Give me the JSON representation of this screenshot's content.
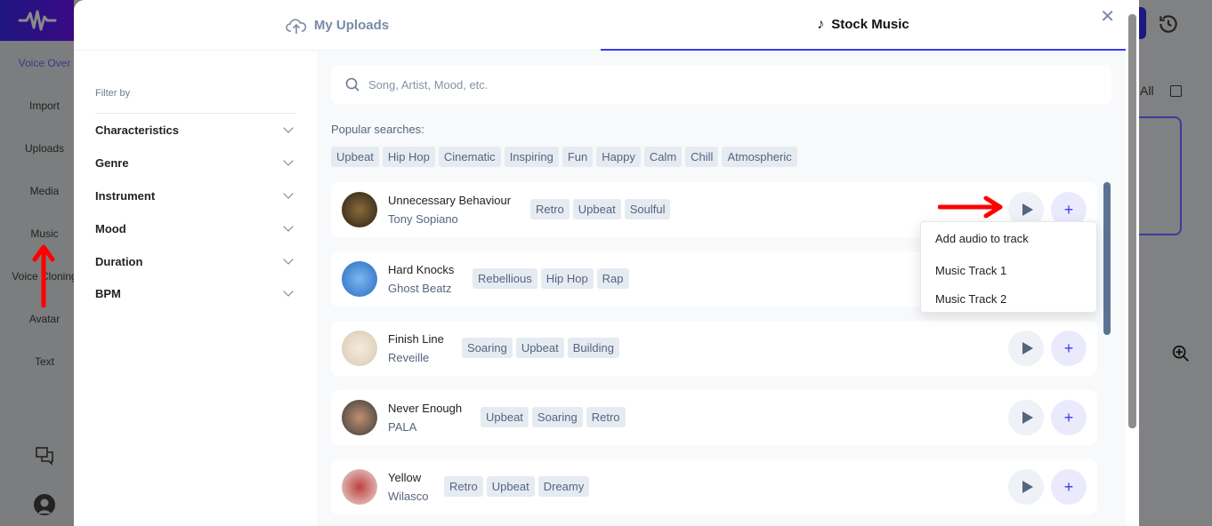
{
  "sidebar": {
    "items": [
      "Voice Over",
      "Import",
      "Uploads",
      "Media",
      "Music",
      "Voice Cloning",
      "Avatar",
      "Text"
    ]
  },
  "background": {
    "select_all": "t All"
  },
  "tabs": {
    "uploads": "My Uploads",
    "stock": "Stock Music"
  },
  "filter": {
    "title": "Filter by",
    "items": [
      "Characteristics",
      "Genre",
      "Instrument",
      "Mood",
      "Duration",
      "BPM"
    ]
  },
  "search": {
    "placeholder": "Song, Artist, Mood, etc."
  },
  "popular": {
    "label": "Popular searches:",
    "chips": [
      "Upbeat",
      "Hip Hop",
      "Cinematic",
      "Inspiring",
      "Fun",
      "Happy",
      "Calm",
      "Chill",
      "Atmospheric"
    ]
  },
  "tracks": [
    {
      "name": "Unnecessary Behaviour",
      "artist": "Tony Sopiano",
      "tags": [
        "Retro",
        "Upbeat",
        "Soulful"
      ]
    },
    {
      "name": "Hard Knocks",
      "artist": "Ghost Beatz",
      "tags": [
        "Rebellious",
        "Hip Hop",
        "Rap"
      ]
    },
    {
      "name": "Finish Line",
      "artist": "Reveille",
      "tags": [
        "Soaring",
        "Upbeat",
        "Building"
      ]
    },
    {
      "name": "Never Enough",
      "artist": "PALA",
      "tags": [
        "Upbeat",
        "Soaring",
        "Retro"
      ]
    },
    {
      "name": "Yellow",
      "artist": "Wilasco",
      "tags": [
        "Retro",
        "Upbeat",
        "Dreamy"
      ]
    }
  ],
  "menu": {
    "title": "Add audio to track",
    "items": [
      "Music Track 1",
      "Music Track 2"
    ]
  },
  "colors": {
    "accent": "#3b3bf0",
    "annotation": "#ff0000"
  }
}
